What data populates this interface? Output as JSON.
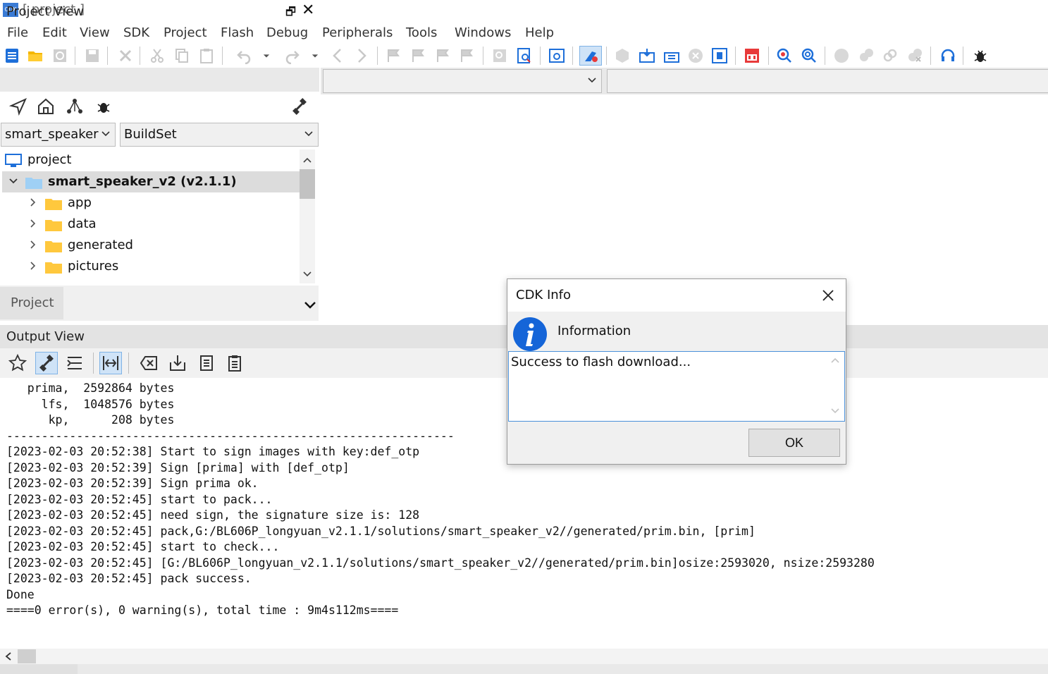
{
  "window": {
    "title": "[ project ]",
    "logo_text": "CDK"
  },
  "menu": [
    "File",
    "Edit",
    "View",
    "SDK",
    "Project",
    "Flash",
    "Debug",
    "Peripherals",
    "Tools",
    "Windows",
    "Help"
  ],
  "project_view": {
    "title": "Project View",
    "float_glyph": "🗗",
    "close_glyph": "✕",
    "project_select": "smart_speaker",
    "buildset_select": "BuildSet",
    "tree": {
      "root": "project",
      "package": "smart_speaker_v2 (v2.1.1)",
      "folders": [
        "app",
        "data",
        "generated",
        "pictures"
      ]
    },
    "footer_tab": "Project"
  },
  "output_view": {
    "title": "Output View",
    "lines": [
      "   prima,  2592864 bytes",
      "     lfs,  1048576 bytes",
      "      kp,      208 bytes",
      "----------------------------------------------------------------",
      "[2023-02-03 20:52:38] Start to sign images with key:def_otp",
      "[2023-02-03 20:52:39] Sign [prima] with [def_otp]",
      "[2023-02-03 20:52:39] Sign prima ok.",
      "[2023-02-03 20:52:45] start to pack...",
      "[2023-02-03 20:52:45] need sign, the signature size is: 128",
      "[2023-02-03 20:52:45] pack,G:/BL606P_longyuan_v2.1.1/solutions/smart_speaker_v2//generated/prim.bin, [prim]",
      "[2023-02-03 20:52:45] start to check...",
      "[2023-02-03 20:52:45] [G:/BL606P_longyuan_v2.1.1/solutions/smart_speaker_v2//generated/prim.bin]osize:2593020, nsize:2593280",
      "[2023-02-03 20:52:45] pack success.",
      "Done",
      "====0 error(s), 0 warning(s), total time : 9m4s112ms===="
    ]
  },
  "dialog": {
    "title": "CDK Info",
    "heading": "Information",
    "message": "Success to flash download...",
    "ok_label": "OK"
  },
  "colors": {
    "accent": "#1e6fd9",
    "info_icon": "#1565d8",
    "toolbar_active": "#cfe3f7"
  }
}
